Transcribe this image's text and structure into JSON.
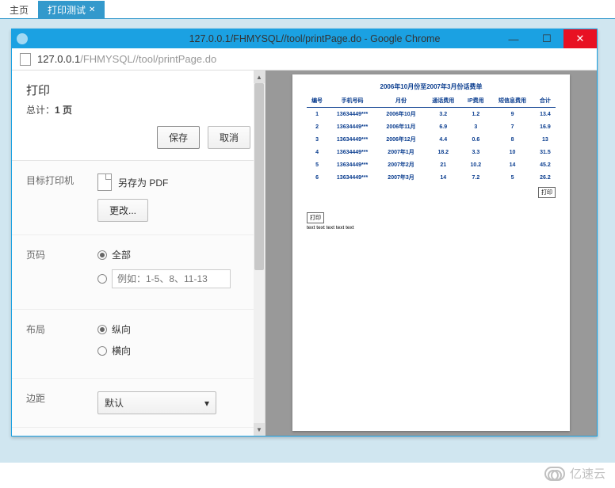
{
  "tabs": {
    "home": "主页",
    "active": "打印测试"
  },
  "window": {
    "title": "127.0.0.1/FHMYSQL//tool/printPage.do - Google Chrome",
    "url_host": "127.0.0.1",
    "url_path": "/FHMYSQL//tool/printPage.do"
  },
  "print": {
    "title": "打印",
    "total_prefix": "总计：",
    "total_value": "1 页",
    "save": "保存",
    "cancel": "取消",
    "dest_label": "目标打印机",
    "dest_value": "另存为 PDF",
    "change": "更改...",
    "pages_label": "页码",
    "pages_all": "全部",
    "pages_range_placeholder": "例如：1-5、8、11-13",
    "layout_label": "布局",
    "layout_portrait": "纵向",
    "layout_landscape": "横向",
    "margins_label": "边距",
    "margins_value": "默认"
  },
  "doc": {
    "title": "2006年10月份至2007年3月份话费单",
    "headers": [
      "编号",
      "手机号码",
      "月份",
      "通话费用",
      "IP费用",
      "短信息费用",
      "合计"
    ],
    "rows": [
      [
        "1",
        "13634449***",
        "2006年10月",
        "3.2",
        "1.2",
        "9",
        "13.4"
      ],
      [
        "2",
        "13634449***",
        "2006年11月",
        "6.9",
        "3",
        "7",
        "16.9"
      ],
      [
        "3",
        "13634449***",
        "2006年12月",
        "4.4",
        "0.6",
        "8",
        "13"
      ],
      [
        "4",
        "13634449***",
        "2007年1月",
        "18.2",
        "3.3",
        "10",
        "31.5"
      ],
      [
        "5",
        "13634449***",
        "2007年2月",
        "21",
        "10.2",
        "14",
        "45.2"
      ],
      [
        "6",
        "13634449***",
        "2007年3月",
        "14",
        "7.2",
        "5",
        "26.2"
      ]
    ],
    "print_btn": "打印",
    "sample_text": "text text text text text"
  },
  "watermark": "亿速云"
}
